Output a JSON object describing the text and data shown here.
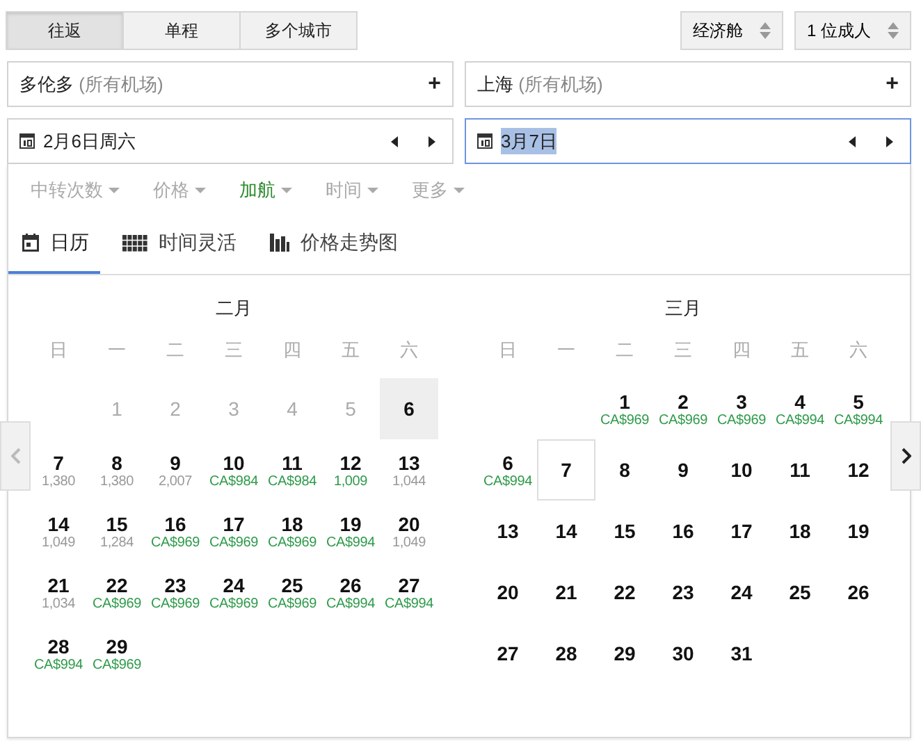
{
  "trip_types": [
    {
      "label": "往返",
      "selected": true
    },
    {
      "label": "单程",
      "selected": false
    },
    {
      "label": "多个城市",
      "selected": false
    }
  ],
  "cabin": {
    "label": "经济舱"
  },
  "passengers": {
    "label": "1 位成人"
  },
  "places": [
    {
      "city": "多伦多",
      "airports": "(所有机场)",
      "add": "+"
    },
    {
      "city": "上海",
      "airports": "(所有机场)",
      "add": "+"
    }
  ],
  "dates": [
    {
      "value": "2月6日周六",
      "focused": false
    },
    {
      "value": "3月7日",
      "focused": true
    }
  ],
  "filters": [
    {
      "label": "中转次数",
      "active": false
    },
    {
      "label": "价格",
      "active": false
    },
    {
      "label": "加航",
      "active": true
    },
    {
      "label": "时间",
      "active": false
    },
    {
      "label": "更多",
      "active": false
    }
  ],
  "views": [
    {
      "label": "日历",
      "kind": "calendar",
      "selected": true
    },
    {
      "label": "时间灵活",
      "kind": "grid",
      "selected": false
    },
    {
      "label": "价格走势图",
      "kind": "chart",
      "selected": false
    }
  ],
  "months": [
    {
      "title": "二月",
      "weekdays": [
        "日",
        "一",
        "二",
        "三",
        "四",
        "五",
        "六"
      ],
      "weeks": [
        [
          {
            "kind": "blank"
          },
          {
            "kind": "day",
            "day": "1",
            "disabled": true,
            "selected": false,
            "focused": false
          },
          {
            "kind": "day",
            "day": "2",
            "disabled": true,
            "selected": false,
            "focused": false
          },
          {
            "kind": "day",
            "day": "3",
            "disabled": true,
            "selected": false,
            "focused": false
          },
          {
            "kind": "day",
            "day": "4",
            "disabled": true,
            "selected": false,
            "focused": false
          },
          {
            "kind": "day",
            "day": "5",
            "disabled": true,
            "selected": false,
            "focused": false
          },
          {
            "kind": "day",
            "day": "6",
            "disabled": false,
            "selected": true,
            "focused": false
          }
        ],
        [
          {
            "kind": "day",
            "day": "7",
            "price": "1,380",
            "cheap": false,
            "disabled": false,
            "selected": false,
            "focused": false
          },
          {
            "kind": "day",
            "day": "8",
            "price": "1,380",
            "cheap": false,
            "disabled": false,
            "selected": false,
            "focused": false
          },
          {
            "kind": "day",
            "day": "9",
            "price": "2,007",
            "cheap": false,
            "disabled": false,
            "selected": false,
            "focused": false
          },
          {
            "kind": "day",
            "day": "10",
            "price": "CA$984",
            "cheap": true,
            "disabled": false,
            "selected": false,
            "focused": false
          },
          {
            "kind": "day",
            "day": "11",
            "price": "CA$984",
            "cheap": true,
            "disabled": false,
            "selected": false,
            "focused": false
          },
          {
            "kind": "day",
            "day": "12",
            "price": "1,009",
            "cheap": true,
            "disabled": false,
            "selected": false,
            "focused": false
          },
          {
            "kind": "day",
            "day": "13",
            "price": "1,044",
            "cheap": false,
            "disabled": false,
            "selected": false,
            "focused": false
          }
        ],
        [
          {
            "kind": "day",
            "day": "14",
            "price": "1,049",
            "cheap": false,
            "disabled": false,
            "selected": false,
            "focused": false
          },
          {
            "kind": "day",
            "day": "15",
            "price": "1,284",
            "cheap": false,
            "disabled": false,
            "selected": false,
            "focused": false
          },
          {
            "kind": "day",
            "day": "16",
            "price": "CA$969",
            "cheap": true,
            "disabled": false,
            "selected": false,
            "focused": false
          },
          {
            "kind": "day",
            "day": "17",
            "price": "CA$969",
            "cheap": true,
            "disabled": false,
            "selected": false,
            "focused": false
          },
          {
            "kind": "day",
            "day": "18",
            "price": "CA$969",
            "cheap": true,
            "disabled": false,
            "selected": false,
            "focused": false
          },
          {
            "kind": "day",
            "day": "19",
            "price": "CA$994",
            "cheap": true,
            "disabled": false,
            "selected": false,
            "focused": false
          },
          {
            "kind": "day",
            "day": "20",
            "price": "1,049",
            "cheap": false,
            "disabled": false,
            "selected": false,
            "focused": false
          }
        ],
        [
          {
            "kind": "day",
            "day": "21",
            "price": "1,034",
            "cheap": false,
            "disabled": false,
            "selected": false,
            "focused": false
          },
          {
            "kind": "day",
            "day": "22",
            "price": "CA$969",
            "cheap": true,
            "disabled": false,
            "selected": false,
            "focused": false
          },
          {
            "kind": "day",
            "day": "23",
            "price": "CA$969",
            "cheap": true,
            "disabled": false,
            "selected": false,
            "focused": false
          },
          {
            "kind": "day",
            "day": "24",
            "price": "CA$969",
            "cheap": true,
            "disabled": false,
            "selected": false,
            "focused": false
          },
          {
            "kind": "day",
            "day": "25",
            "price": "CA$969",
            "cheap": true,
            "disabled": false,
            "selected": false,
            "focused": false
          },
          {
            "kind": "day",
            "day": "26",
            "price": "CA$994",
            "cheap": true,
            "disabled": false,
            "selected": false,
            "focused": false
          },
          {
            "kind": "day",
            "day": "27",
            "price": "CA$994",
            "cheap": true,
            "disabled": false,
            "selected": false,
            "focused": false
          }
        ],
        [
          {
            "kind": "day",
            "day": "28",
            "price": "CA$994",
            "cheap": true,
            "disabled": false,
            "selected": false,
            "focused": false
          },
          {
            "kind": "day",
            "day": "29",
            "price": "CA$969",
            "cheap": true,
            "disabled": false,
            "selected": false,
            "focused": false
          }
        ]
      ]
    },
    {
      "title": "三月",
      "weekdays": [
        "日",
        "一",
        "二",
        "三",
        "四",
        "五",
        "六"
      ],
      "weeks": [
        [
          {
            "kind": "blank"
          },
          {
            "kind": "blank"
          },
          {
            "kind": "day",
            "day": "1",
            "price": "CA$969",
            "cheap": true,
            "disabled": false,
            "selected": false,
            "focused": false
          },
          {
            "kind": "day",
            "day": "2",
            "price": "CA$969",
            "cheap": true,
            "disabled": false,
            "selected": false,
            "focused": false
          },
          {
            "kind": "day",
            "day": "3",
            "price": "CA$969",
            "cheap": true,
            "disabled": false,
            "selected": false,
            "focused": false
          },
          {
            "kind": "day",
            "day": "4",
            "price": "CA$994",
            "cheap": true,
            "disabled": false,
            "selected": false,
            "focused": false
          },
          {
            "kind": "day",
            "day": "5",
            "price": "CA$994",
            "cheap": true,
            "disabled": false,
            "selected": false,
            "focused": false
          }
        ],
        [
          {
            "kind": "day",
            "day": "6",
            "price": "CA$994",
            "cheap": true,
            "disabled": false,
            "selected": false,
            "focused": false
          },
          {
            "kind": "day",
            "day": "7",
            "disabled": false,
            "selected": false,
            "focused": true
          },
          {
            "kind": "day",
            "day": "8",
            "disabled": false,
            "selected": false,
            "focused": false
          },
          {
            "kind": "day",
            "day": "9",
            "disabled": false,
            "selected": false,
            "focused": false
          },
          {
            "kind": "day",
            "day": "10",
            "disabled": false,
            "selected": false,
            "focused": false
          },
          {
            "kind": "day",
            "day": "11",
            "disabled": false,
            "selected": false,
            "focused": false
          },
          {
            "kind": "day",
            "day": "12",
            "disabled": false,
            "selected": false,
            "focused": false
          }
        ],
        [
          {
            "kind": "day",
            "day": "13",
            "disabled": false,
            "selected": false,
            "focused": false
          },
          {
            "kind": "day",
            "day": "14",
            "disabled": false,
            "selected": false,
            "focused": false
          },
          {
            "kind": "day",
            "day": "15",
            "disabled": false,
            "selected": false,
            "focused": false
          },
          {
            "kind": "day",
            "day": "16",
            "disabled": false,
            "selected": false,
            "focused": false
          },
          {
            "kind": "day",
            "day": "17",
            "disabled": false,
            "selected": false,
            "focused": false
          },
          {
            "kind": "day",
            "day": "18",
            "disabled": false,
            "selected": false,
            "focused": false
          },
          {
            "kind": "day",
            "day": "19",
            "disabled": false,
            "selected": false,
            "focused": false
          }
        ],
        [
          {
            "kind": "day",
            "day": "20",
            "disabled": false,
            "selected": false,
            "focused": false
          },
          {
            "kind": "day",
            "day": "21",
            "disabled": false,
            "selected": false,
            "focused": false
          },
          {
            "kind": "day",
            "day": "22",
            "disabled": false,
            "selected": false,
            "focused": false
          },
          {
            "kind": "day",
            "day": "23",
            "disabled": false,
            "selected": false,
            "focused": false
          },
          {
            "kind": "day",
            "day": "24",
            "disabled": false,
            "selected": false,
            "focused": false
          },
          {
            "kind": "day",
            "day": "25",
            "disabled": false,
            "selected": false,
            "focused": false
          },
          {
            "kind": "day",
            "day": "26",
            "disabled": false,
            "selected": false,
            "focused": false
          }
        ],
        [
          {
            "kind": "day",
            "day": "27",
            "disabled": false,
            "selected": false,
            "focused": false
          },
          {
            "kind": "day",
            "day": "28",
            "disabled": false,
            "selected": false,
            "focused": false
          },
          {
            "kind": "day",
            "day": "29",
            "disabled": false,
            "selected": false,
            "focused": false
          },
          {
            "kind": "day",
            "day": "30",
            "disabled": false,
            "selected": false,
            "focused": false
          },
          {
            "kind": "day",
            "day": "31",
            "disabled": false,
            "selected": false,
            "focused": false
          }
        ]
      ]
    }
  ]
}
